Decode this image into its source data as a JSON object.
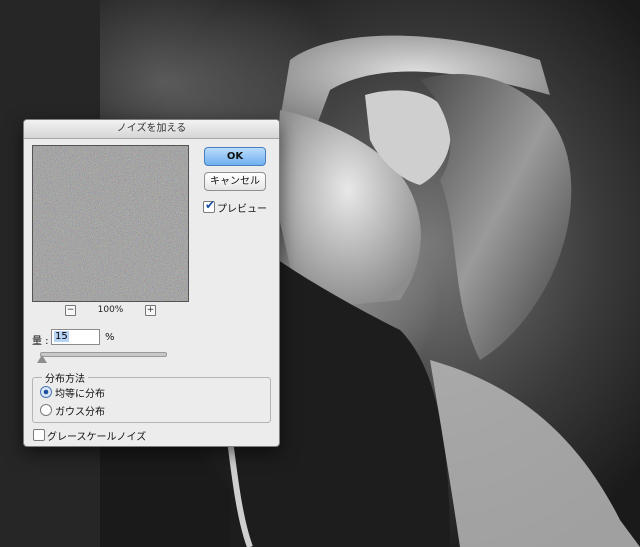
{
  "dialog": {
    "title": "ノイズを加える",
    "ok_label": "OK",
    "cancel_label": "キャンセル",
    "preview_label": "プレビュー",
    "preview_checked": true,
    "zoom_out_symbol": "−",
    "zoom_in_symbol": "+",
    "zoom_level": "100%",
    "amount_label": "量 :",
    "amount_value": "15",
    "amount_unit": "%",
    "distribution": {
      "title": "分布方法",
      "options": [
        {
          "label": "均等に分布",
          "selected": true
        },
        {
          "label": "ガウス分布",
          "selected": false
        }
      ]
    },
    "grayscale_label": "グレースケールノイズ",
    "grayscale_checked": false
  },
  "colors": {
    "ok_accent": "#6fb0ef",
    "dialog_bg": "#ececec",
    "app_bg": "#262626"
  },
  "icons": {
    "zoom_out": "minus-box-icon",
    "zoom_in": "plus-box-icon",
    "checkmark": "check-icon"
  }
}
